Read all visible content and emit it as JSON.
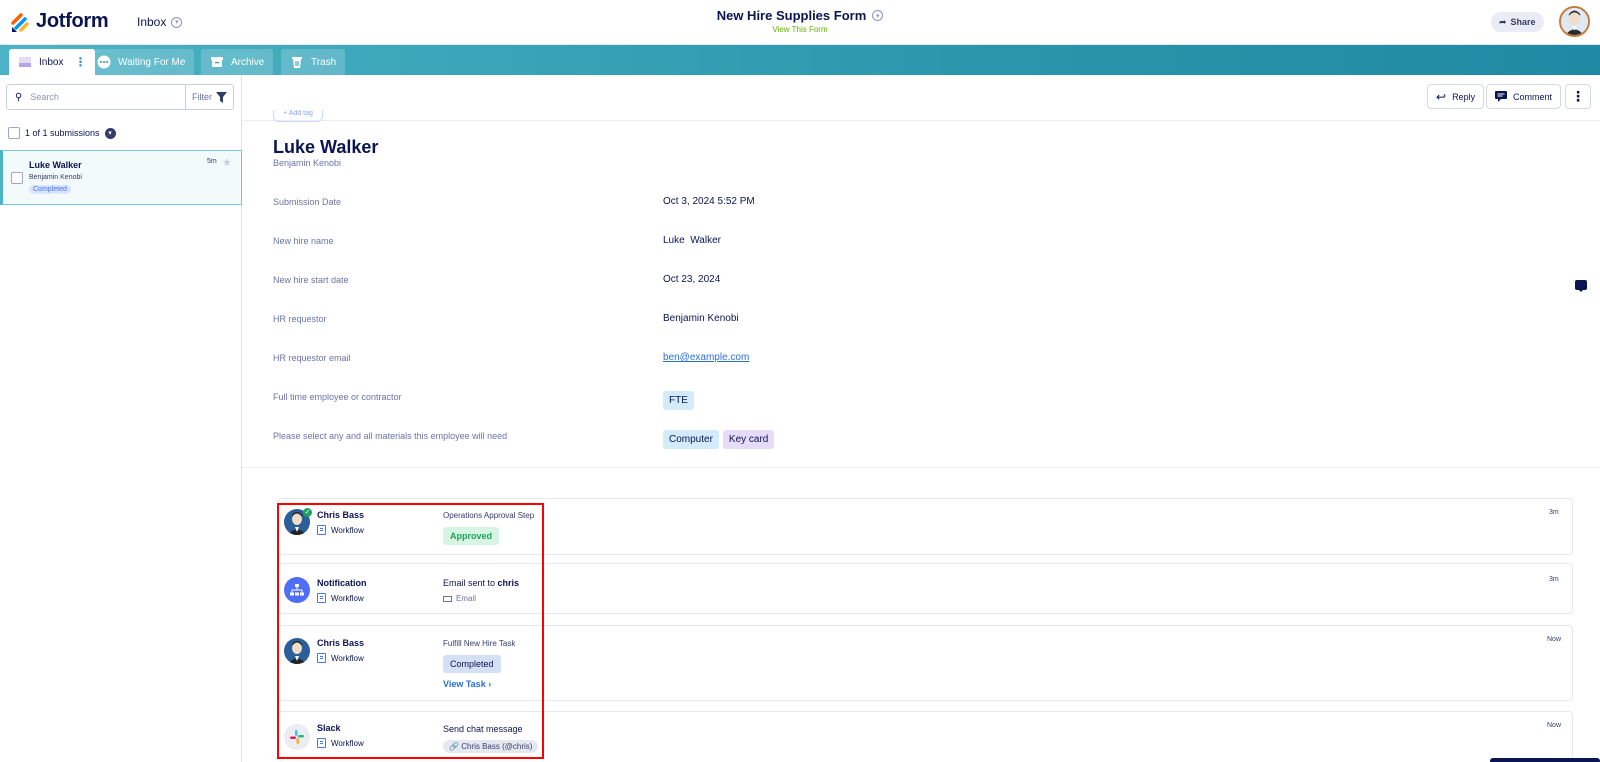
{
  "header": {
    "brand": "Jotform",
    "inbox_switch": "Inbox",
    "form_title": "New Hire Supplies Form",
    "view_form": "View This Form",
    "share_label": "Share"
  },
  "tabs": [
    {
      "label": "Inbox",
      "icon": "inbox-icon"
    },
    {
      "label": "Waiting For Me",
      "icon": "waiting-icon"
    },
    {
      "label": "Archive",
      "icon": "archive-icon"
    },
    {
      "label": "Trash",
      "icon": "trash-icon"
    }
  ],
  "sidebar": {
    "search_placeholder": "Search",
    "filter_label": "Filter",
    "count_text": "1 of 1 submissions",
    "submission": {
      "name": "Luke Walker",
      "requester": "Benjamin Kenobi",
      "status": "Completed",
      "time": "5m"
    }
  },
  "toolbar": {
    "reply": "Reply",
    "comment": "Comment",
    "more": "⋮"
  },
  "detail": {
    "tag_peek": "+ Add tag",
    "name": "Luke Walker",
    "subtitle": "Benjamin Kenobi",
    "fields": [
      {
        "label": "Submission Date",
        "value": "Oct 3, 2024 5:52 PM"
      },
      {
        "label": "New hire name",
        "value": "Luke  Walker"
      },
      {
        "label": "New hire start date",
        "value": "Oct 23, 2024"
      },
      {
        "label": "HR requestor",
        "value": "Benjamin Kenobi"
      },
      {
        "label": "HR requestor email",
        "value": "ben@example.com"
      },
      {
        "label": "Full time employee or contractor",
        "chips": [
          "FTE"
        ]
      },
      {
        "label": "Please select any and all materials this employee will need",
        "chips": [
          "Computer",
          "Key card"
        ]
      }
    ]
  },
  "timeline": [
    {
      "actor": "Chris Bass",
      "flow": "Workflow",
      "step": "Operations Approval Step",
      "badge": "Approved",
      "time": "3m"
    },
    {
      "actor": "Notification",
      "flow": "Workflow",
      "desc_prefix": "Email sent to ",
      "desc_bold": "chris",
      "sub": "Email",
      "time": "3m"
    },
    {
      "actor": "Chris Bass",
      "flow": "Workflow",
      "step": "Fulfill New Hire Task",
      "badge": "Completed",
      "link": "View Task",
      "time": "Now"
    },
    {
      "actor": "Slack",
      "flow": "Workflow",
      "desc": "Send chat message",
      "chip": "Chris Bass (@chris)",
      "time": "Now"
    }
  ],
  "colors": {
    "brand_navy": "#0a1551",
    "tab_bar": "#2a97ac",
    "approved": "#1fa35c",
    "link": "#2a6fd6",
    "highlight_box": "#ff0000"
  }
}
